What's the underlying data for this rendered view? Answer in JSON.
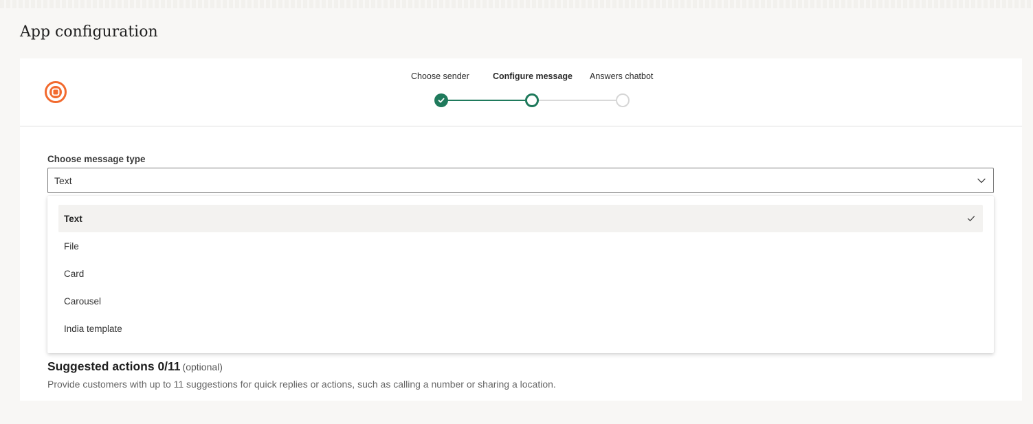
{
  "page": {
    "title": "App configuration"
  },
  "stepper": {
    "steps": [
      {
        "label": "Choose sender",
        "state": "complete"
      },
      {
        "label": "Configure message",
        "state": "current"
      },
      {
        "label": "Answers chatbot",
        "state": "upcoming"
      }
    ],
    "colors": {
      "active": "#1f7a5c",
      "inactive": "#d9d9d9"
    }
  },
  "message_type": {
    "label": "Choose message type",
    "selected_value": "Text",
    "options": [
      {
        "label": "Text",
        "selected": true
      },
      {
        "label": "File",
        "selected": false
      },
      {
        "label": "Card",
        "selected": false
      },
      {
        "label": "Carousel",
        "selected": false
      },
      {
        "label": "India template",
        "selected": false
      }
    ]
  },
  "suggested_actions": {
    "title": "Suggested actions 0/11",
    "optional_label": "(optional)",
    "description": "Provide customers with up to 11 suggestions for quick replies or actions, such as calling a number or sharing a location."
  },
  "icons": {
    "logo": "brand-logo-icon",
    "step_complete": "check-icon",
    "select": "chevron-down-icon",
    "option_selected": "check-icon"
  },
  "brand_color": "#f26a2e"
}
